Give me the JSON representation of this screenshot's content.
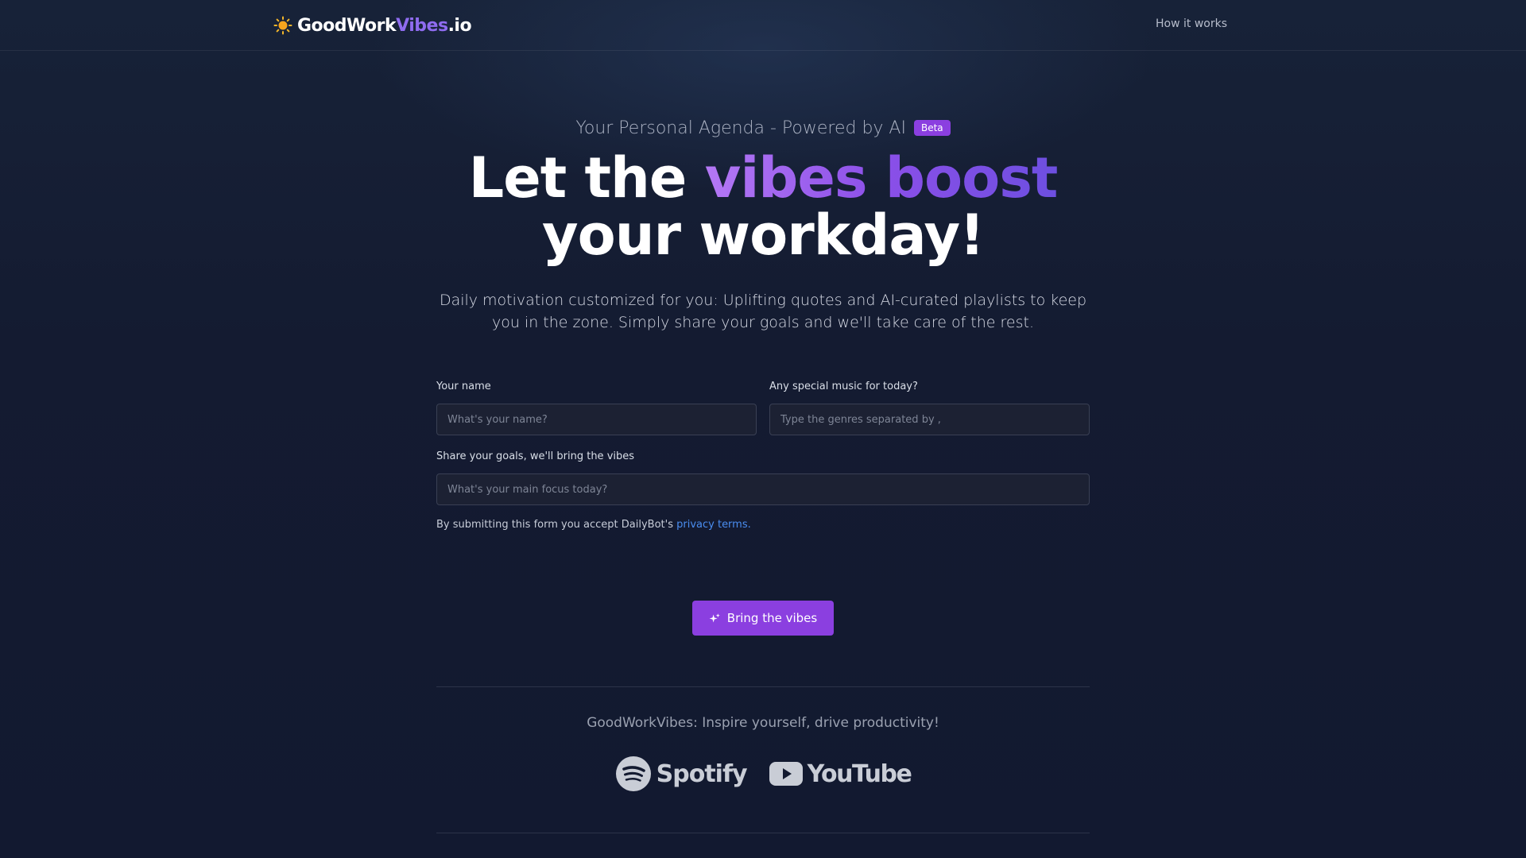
{
  "brand": {
    "part_white": "GoodWork",
    "part_accent": "Vibes",
    "part_suffix": ".io",
    "icon": "sun-icon"
  },
  "nav": {
    "how_it_works": "How it works"
  },
  "hero": {
    "eyebrow": "Your Personal Agenda - Powered by AI",
    "badge": "Beta",
    "headline_prefix": "Let the",
    "headline_highlight": "vibes boost",
    "headline_line2": "your workday!",
    "subtitle": "Daily motivation customized for you: Uplifting quotes and AI-curated playlists to keep you in the zone. Simply share your goals and we'll take care of the rest."
  },
  "form": {
    "name_label": "Your name",
    "name_placeholder": "What's your name?",
    "music_label": "Any special music for today?",
    "music_placeholder": "Type the genres separated by ,",
    "goals_label": "Share your goals, we'll bring the vibes",
    "goals_placeholder": "What's your main focus today?",
    "terms_text": "By submitting this form you accept DailyBot's",
    "terms_link": "privacy terms.",
    "submit_label": "Bring the vibes",
    "submit_icon": "sparkles-icon"
  },
  "footer": {
    "tagline": "GoodWorkVibes: Inspire yourself, drive productivity!",
    "spotify": "Spotify",
    "youtube": "YouTube"
  },
  "colors": {
    "accent": "#8b3fe0",
    "link": "#4a8df0",
    "background": "#131a30"
  }
}
